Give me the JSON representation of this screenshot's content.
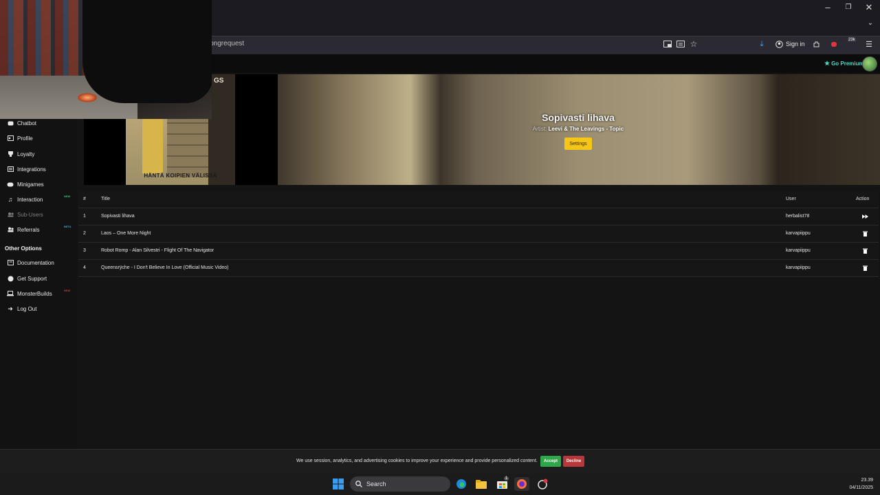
{
  "browser": {
    "url": "nel/songrequest",
    "sign_in": "Sign in",
    "extension_count": "23k"
  },
  "site": {
    "go_premium": "Go Premium"
  },
  "sidebar": {
    "items": [
      {
        "label": "Chatbot",
        "icon": "robot-icon"
      },
      {
        "label": "Profile",
        "icon": "profile-icon"
      },
      {
        "label": "Loyalty",
        "icon": "trophy-icon"
      },
      {
        "label": "Integrations",
        "icon": "integrations-icon"
      },
      {
        "label": "Minigames",
        "icon": "gamepad-icon"
      },
      {
        "label": "Interaction",
        "icon": "music-icon",
        "tag": "NEW"
      },
      {
        "label": "Sub-Users",
        "icon": "users-icon"
      },
      {
        "label": "Referrals",
        "icon": "referral-icon",
        "tag": "BETA"
      }
    ],
    "other_heading": "Other Options",
    "other_items": [
      {
        "label": "Documentation",
        "icon": "book-icon"
      },
      {
        "label": "Get Support",
        "icon": "support-icon"
      },
      {
        "label": "MonsterBuilds",
        "icon": "laptop-icon",
        "tag": "NEW"
      },
      {
        "label": "Log Out",
        "icon": "logout-icon"
      }
    ]
  },
  "now_playing": {
    "title": "Sopivasti lihava",
    "artist_label": "Artist:",
    "artist": "Leevi & The Leavings - Topic",
    "settings_label": "Settings",
    "cover_text": "HÄNTÄ KOIPIEN VÄLISSÄ",
    "cover_top_text": "GS"
  },
  "queue": {
    "headers": {
      "num": "#",
      "title": "Title",
      "user": "User",
      "action": "Action"
    },
    "rows": [
      {
        "num": "1",
        "title": "Sopivasti lihava",
        "user": "herbalist78",
        "action": "skip"
      },
      {
        "num": "2",
        "title": "Laos – One More Night",
        "user": "karvapiippu",
        "action": "delete"
      },
      {
        "num": "3",
        "title": "Robot Romp - Alan Silvestri - Flight Of The Navigator",
        "user": "karvapiippu",
        "action": "delete"
      },
      {
        "num": "4",
        "title": "Queensrÿche - I Don't Believe In Love (Official Music Video)",
        "user": "karvapiippu",
        "action": "delete"
      }
    ]
  },
  "cookie": {
    "text": "We use session, analytics, and advertising cookies to improve your experience and provide personalized content.",
    "accept": "Accept",
    "decline": "Decline"
  },
  "taskbar": {
    "search": "Search",
    "time": "23.39",
    "date": "04/11/2025",
    "store_badge": "1"
  },
  "colors": {
    "accent_yellow": "#f5c518",
    "premium": "#4fd6c4",
    "accept": "#2fa84a",
    "decline": "#b8383a"
  }
}
